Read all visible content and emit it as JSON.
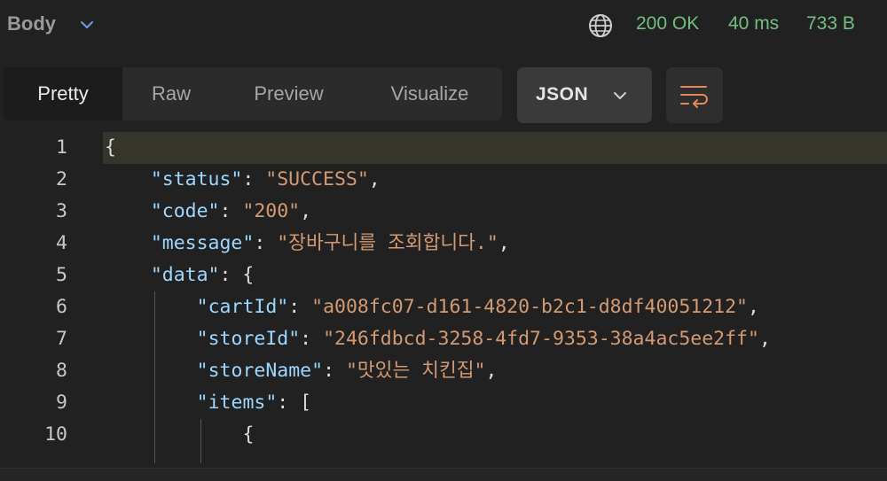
{
  "header": {
    "section_label": "Body",
    "status": "200 OK",
    "time": "40 ms",
    "size": "733 B"
  },
  "view_tabs": [
    {
      "label": "Pretty",
      "active": true
    },
    {
      "label": "Raw",
      "active": false
    },
    {
      "label": "Preview",
      "active": false
    },
    {
      "label": "Visualize",
      "active": false
    }
  ],
  "format_select": {
    "value": "JSON"
  },
  "icons": {
    "section_toggle": "chevron-down-icon",
    "network": "globe-icon",
    "format_toggle": "chevron-down-icon",
    "wrap": "wrap-lines-icon"
  },
  "colors": {
    "status_ok": "#72c07e",
    "key": "#9cd7ff",
    "string": "#d49a74",
    "wrap_icon": "#e8875a"
  },
  "editor": {
    "lines": [
      {
        "n": "1",
        "indent": 0,
        "key": "",
        "value": "",
        "open": "{",
        "comma": false
      },
      {
        "n": "2",
        "indent": 1,
        "key": "\"status\"",
        "value": "\"SUCCESS\"",
        "open": "",
        "comma": true
      },
      {
        "n": "3",
        "indent": 1,
        "key": "\"code\"",
        "value": "\"200\"",
        "open": "",
        "comma": true
      },
      {
        "n": "4",
        "indent": 1,
        "key": "\"message\"",
        "value": "\"장바구니를 조회합니다.\"",
        "open": "",
        "comma": true
      },
      {
        "n": "5",
        "indent": 1,
        "key": "\"data\"",
        "value": "",
        "open": "{",
        "comma": false
      },
      {
        "n": "6",
        "indent": 2,
        "key": "\"cartId\"",
        "value": "\"a008fc07-d161-4820-b2c1-d8df40051212\"",
        "open": "",
        "comma": true
      },
      {
        "n": "7",
        "indent": 2,
        "key": "\"storeId\"",
        "value": "\"246fdbcd-3258-4fd7-9353-38a4ac5ee2ff\"",
        "open": "",
        "comma": true
      },
      {
        "n": "8",
        "indent": 2,
        "key": "\"storeName\"",
        "value": "\"맛있는 치킨집\"",
        "open": "",
        "comma": true
      },
      {
        "n": "9",
        "indent": 2,
        "key": "\"items\"",
        "value": "",
        "open": "[",
        "comma": false
      },
      {
        "n": "10",
        "indent": 3,
        "key": "",
        "value": "",
        "open": "{",
        "comma": false
      }
    ]
  }
}
